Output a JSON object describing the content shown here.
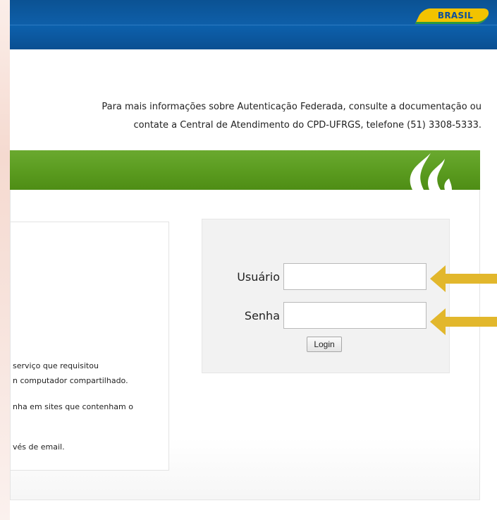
{
  "header": {
    "brand_label": "BRASIL"
  },
  "info": {
    "line1": "Para mais informações sobre Autenticação Federada, consulte a documentação ou",
    "line2": "contate a Central de Atendimento do CPD-UFRGS, telefone (51) 3308-5333."
  },
  "notice": {
    "lines": [
      "serviço que requisitou",
      "n computador compartilhado.",
      "nha em sites que contenham o",
      "vés de email."
    ]
  },
  "login": {
    "username_label": "Usuário",
    "username_value": "",
    "password_label": "Senha",
    "password_value": "",
    "button_label": "Login"
  },
  "colors": {
    "gov_blue": "#0b5aa5",
    "brand_yellow": "#f2c300",
    "ufrgs_green": "#5a9b1f",
    "arrow_gold": "#e2b72c"
  },
  "icons": {
    "logo": "ufrgs-flame-icon",
    "pointer": "arrow-left-icon"
  }
}
